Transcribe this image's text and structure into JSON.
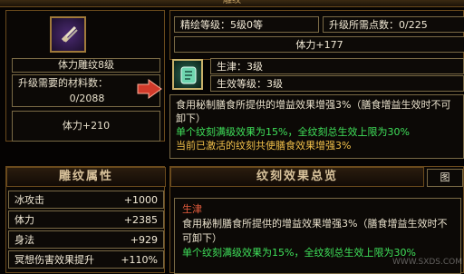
{
  "window": {
    "title": "雕纹"
  },
  "left_panel": {
    "item_icon_name": "carved-scroll-icon",
    "item_title": "体力雕纹8级",
    "materials_label": "升级需要的材料数：",
    "materials_value": "0/2088",
    "stat_value": "体力+210"
  },
  "top_info": {
    "refine_level": "精绘等级：5级0等",
    "upgrade_points": "升级所需点数：0/225",
    "stat": "体力+177"
  },
  "rune": {
    "icon_name": "jade-rune-icon",
    "name_line": "生津：3级",
    "effect_level_line": "生效等级：3级"
  },
  "description": {
    "line1": "食用秘制膳食所提供的增益效果增强3%（膳食增益生效时不可卸下）",
    "line2": "单个纹刻满级效果为15%，全纹刻总生效上限为30%",
    "line3": "当前已激活的纹刻共使膳食效果增强3%"
  },
  "attributes": {
    "header": "雕纹属性",
    "items": [
      {
        "name": "冰攻击",
        "value": "+1000"
      },
      {
        "name": "体力",
        "value": "+2385"
      },
      {
        "name": "身法",
        "value": "+929"
      },
      {
        "name": "冥想伤害效果提升",
        "value": "+110%"
      }
    ]
  },
  "overview": {
    "header": "纹刻效果总览",
    "tab_label": "图",
    "entry_title": "生津",
    "entry_line1": "食用秘制膳食所提供的增益效果增强3%（膳食增益生效时不可卸下）",
    "entry_line2": "单个纹刻满级效果为15%，全纹刻总生效上限为30%"
  },
  "watermark": {
    "url": "WWW.SXDS.COM"
  },
  "colors": {
    "gold_border": "#6a4a1c",
    "green_text": "#3fe05a",
    "orange_text": "#f1c04a",
    "red_arrow": "#d23a2a"
  }
}
